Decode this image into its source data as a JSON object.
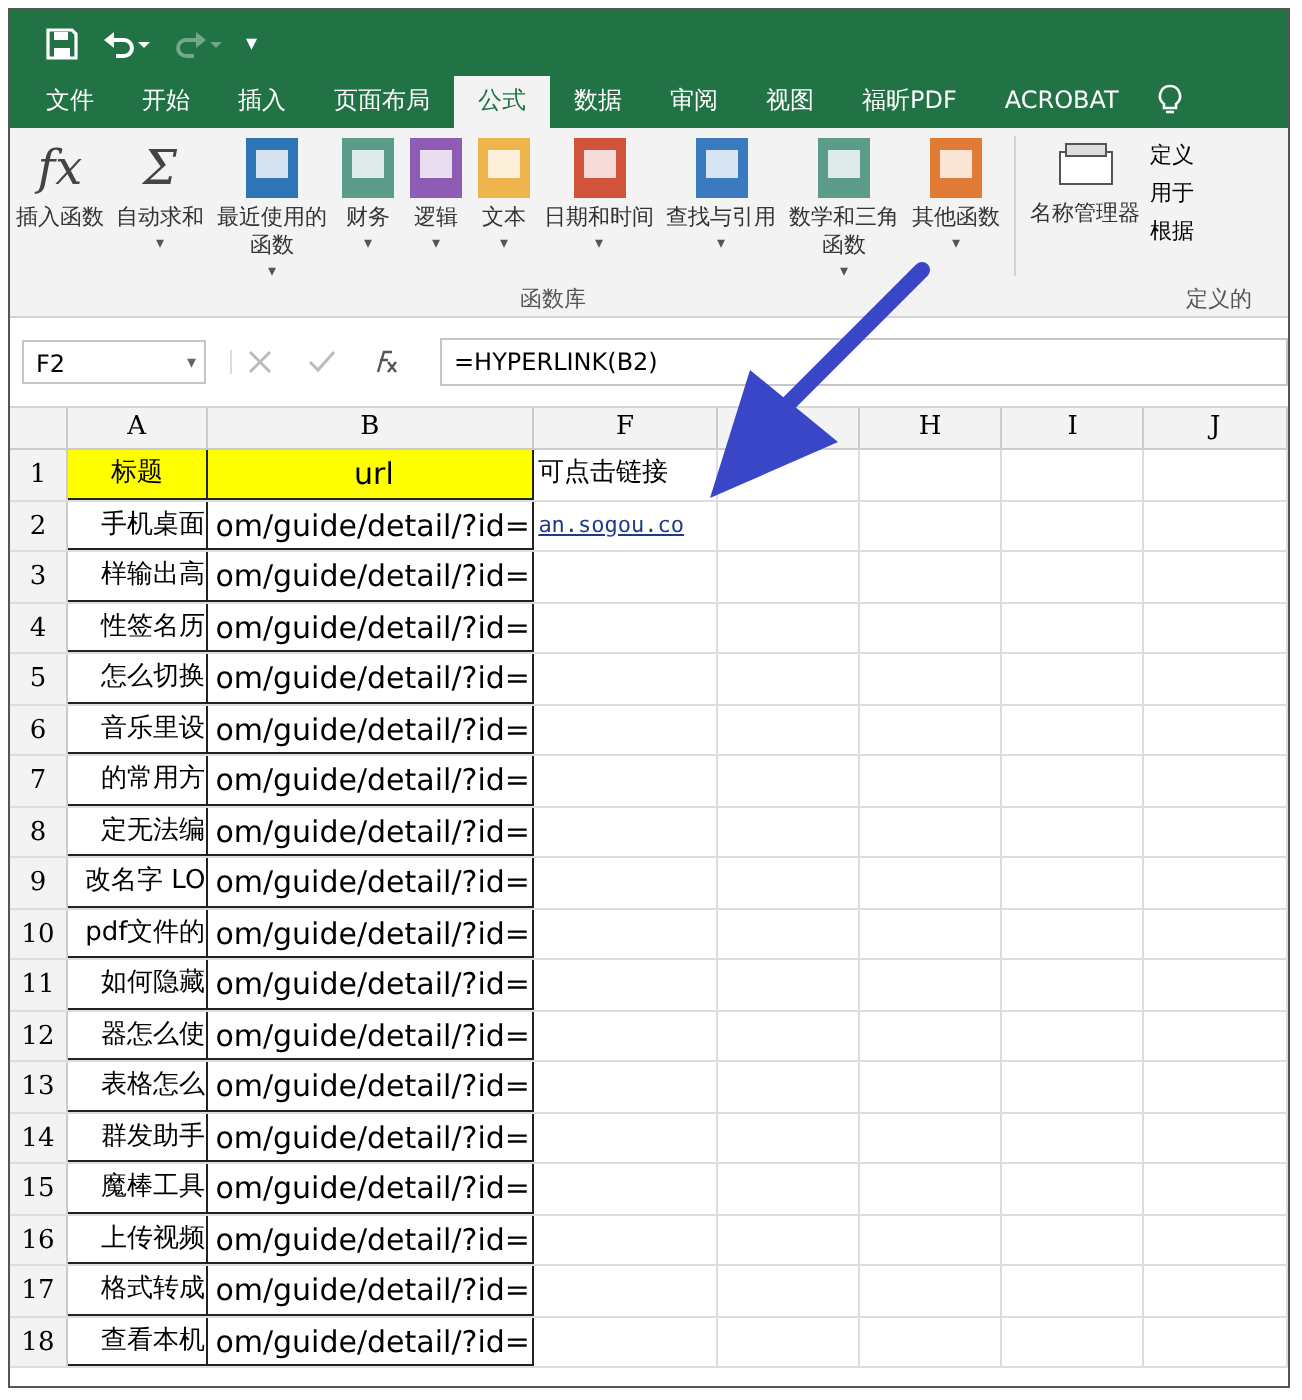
{
  "quick_access": {
    "customize": "▾"
  },
  "tabs": [
    {
      "label": "文件",
      "selected": false
    },
    {
      "label": "开始",
      "selected": false
    },
    {
      "label": "插入",
      "selected": false
    },
    {
      "label": "页面布局",
      "selected": false
    },
    {
      "label": "公式",
      "selected": true
    },
    {
      "label": "数据",
      "selected": false
    },
    {
      "label": "审阅",
      "selected": false
    },
    {
      "label": "视图",
      "selected": false
    },
    {
      "label": "福昕PDF",
      "selected": false
    },
    {
      "label": "ACROBAT",
      "selected": false
    }
  ],
  "ribbon": {
    "caret": "▾",
    "group_label": "函数库",
    "items": [
      {
        "kind": "glyph",
        "glyph": "fx",
        "label": "插入函数",
        "dropdown": false
      },
      {
        "kind": "glyph",
        "glyph": "Σ",
        "label": "自动求和",
        "dropdown": true
      },
      {
        "kind": "book",
        "color": "#2e75b6",
        "label": "最近使用的函数",
        "dropdown": true
      },
      {
        "kind": "book",
        "color": "#5b9b8a",
        "label": "财务",
        "dropdown": true
      },
      {
        "kind": "book",
        "color": "#8e5cb5",
        "label": "逻辑",
        "dropdown": true
      },
      {
        "kind": "book",
        "color": "#f0b44c",
        "label": "文本",
        "dropdown": true
      },
      {
        "kind": "book",
        "color": "#d2533c",
        "label": "日期和时间",
        "dropdown": true
      },
      {
        "kind": "book",
        "color": "#3a7bbf",
        "label": "查找与引用",
        "dropdown": true
      },
      {
        "kind": "book",
        "color": "#5b9b8a",
        "label": "数学和三角函数",
        "dropdown": true
      },
      {
        "kind": "book",
        "color": "#e07b35",
        "label": "其他函数",
        "dropdown": true
      }
    ],
    "names_button": "名称管理器",
    "side_items": [
      "定义",
      "用于",
      "根据"
    ],
    "side_group_label": "定义的"
  },
  "formula_bar": {
    "name_box": "F2",
    "name_box_caret": "▾",
    "formula": "=HYPERLINK(B2)"
  },
  "columns": [
    "A",
    "B",
    "F",
    "",
    "H",
    "I",
    "J"
  ],
  "rows": [
    {
      "num": "1",
      "a": "标题",
      "b": "url",
      "f": "可点击链接",
      "header": true
    },
    {
      "num": "2",
      "a": "手机桌面",
      "b": "om/guide/detail/?id=",
      "f": "an.sogou.co",
      "header": false
    },
    {
      "num": "3",
      "a": "样输出高",
      "b": "om/guide/detail/?id=",
      "f": "",
      "header": false
    },
    {
      "num": "4",
      "a": "性签名历",
      "b": "om/guide/detail/?id=",
      "f": "",
      "header": false
    },
    {
      "num": "5",
      "a": "怎么切换",
      "b": "om/guide/detail/?id=",
      "f": "",
      "header": false
    },
    {
      "num": "6",
      "a": "音乐里设",
      "b": "om/guide/detail/?id=",
      "f": "",
      "header": false
    },
    {
      "num": "7",
      "a": "的常用方",
      "b": "om/guide/detail/?id=",
      "f": "",
      "header": false
    },
    {
      "num": "8",
      "a": "定无法编",
      "b": "om/guide/detail/?id=",
      "f": "",
      "header": false
    },
    {
      "num": "9",
      "a": "改名字 LO",
      "b": "om/guide/detail/?id=",
      "f": "",
      "header": false
    },
    {
      "num": "10",
      "a": "pdf文件的",
      "b": "om/guide/detail/?id=",
      "f": "",
      "header": false
    },
    {
      "num": "11",
      "a": "如何隐藏",
      "b": "om/guide/detail/?id=",
      "f": "",
      "header": false
    },
    {
      "num": "12",
      "a": "器怎么使",
      "b": "om/guide/detail/?id=",
      "f": "",
      "header": false
    },
    {
      "num": "13",
      "a": "表格怎么",
      "b": "om/guide/detail/?id=",
      "f": "",
      "header": false
    },
    {
      "num": "14",
      "a": "群发助手",
      "b": "om/guide/detail/?id=",
      "f": "",
      "header": false
    },
    {
      "num": "15",
      "a": "魔棒工具",
      "b": "om/guide/detail/?id=",
      "f": "",
      "header": false
    },
    {
      "num": "16",
      "a": "上传视频",
      "b": "om/guide/detail/?id=",
      "f": "",
      "header": false
    },
    {
      "num": "17",
      "a": "格式转成",
      "b": "om/guide/detail/?id=",
      "f": "",
      "header": false
    },
    {
      "num": "18",
      "a": "查看本机",
      "b": "om/guide/detail/?id=",
      "f": "",
      "header": false
    }
  ]
}
